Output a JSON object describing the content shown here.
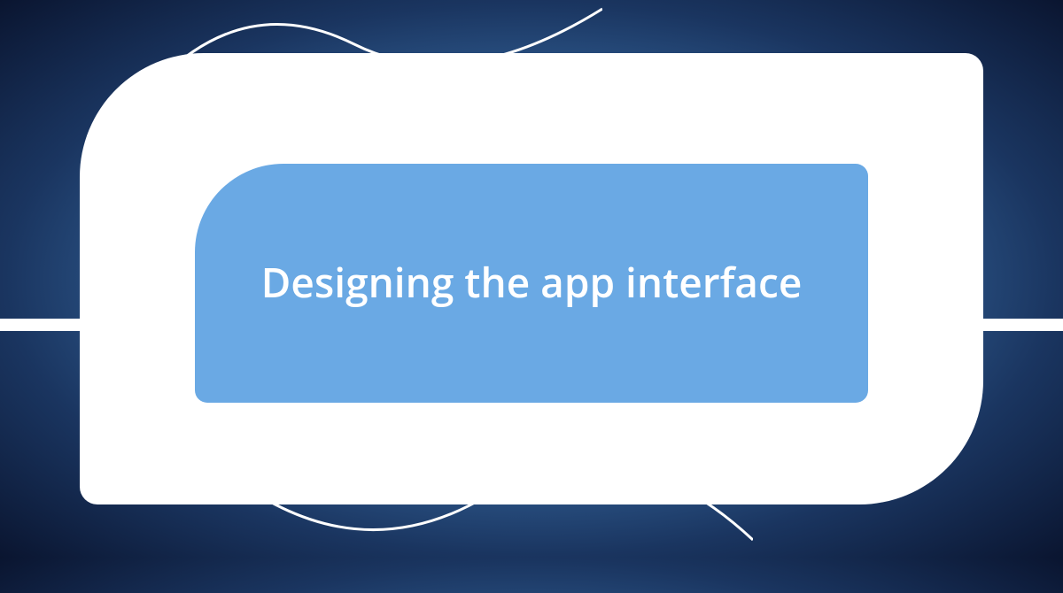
{
  "card": {
    "title": "Designing the app interface"
  },
  "colors": {
    "inner_bg": "#6aa9e4",
    "outer_bg": "#ffffff"
  }
}
